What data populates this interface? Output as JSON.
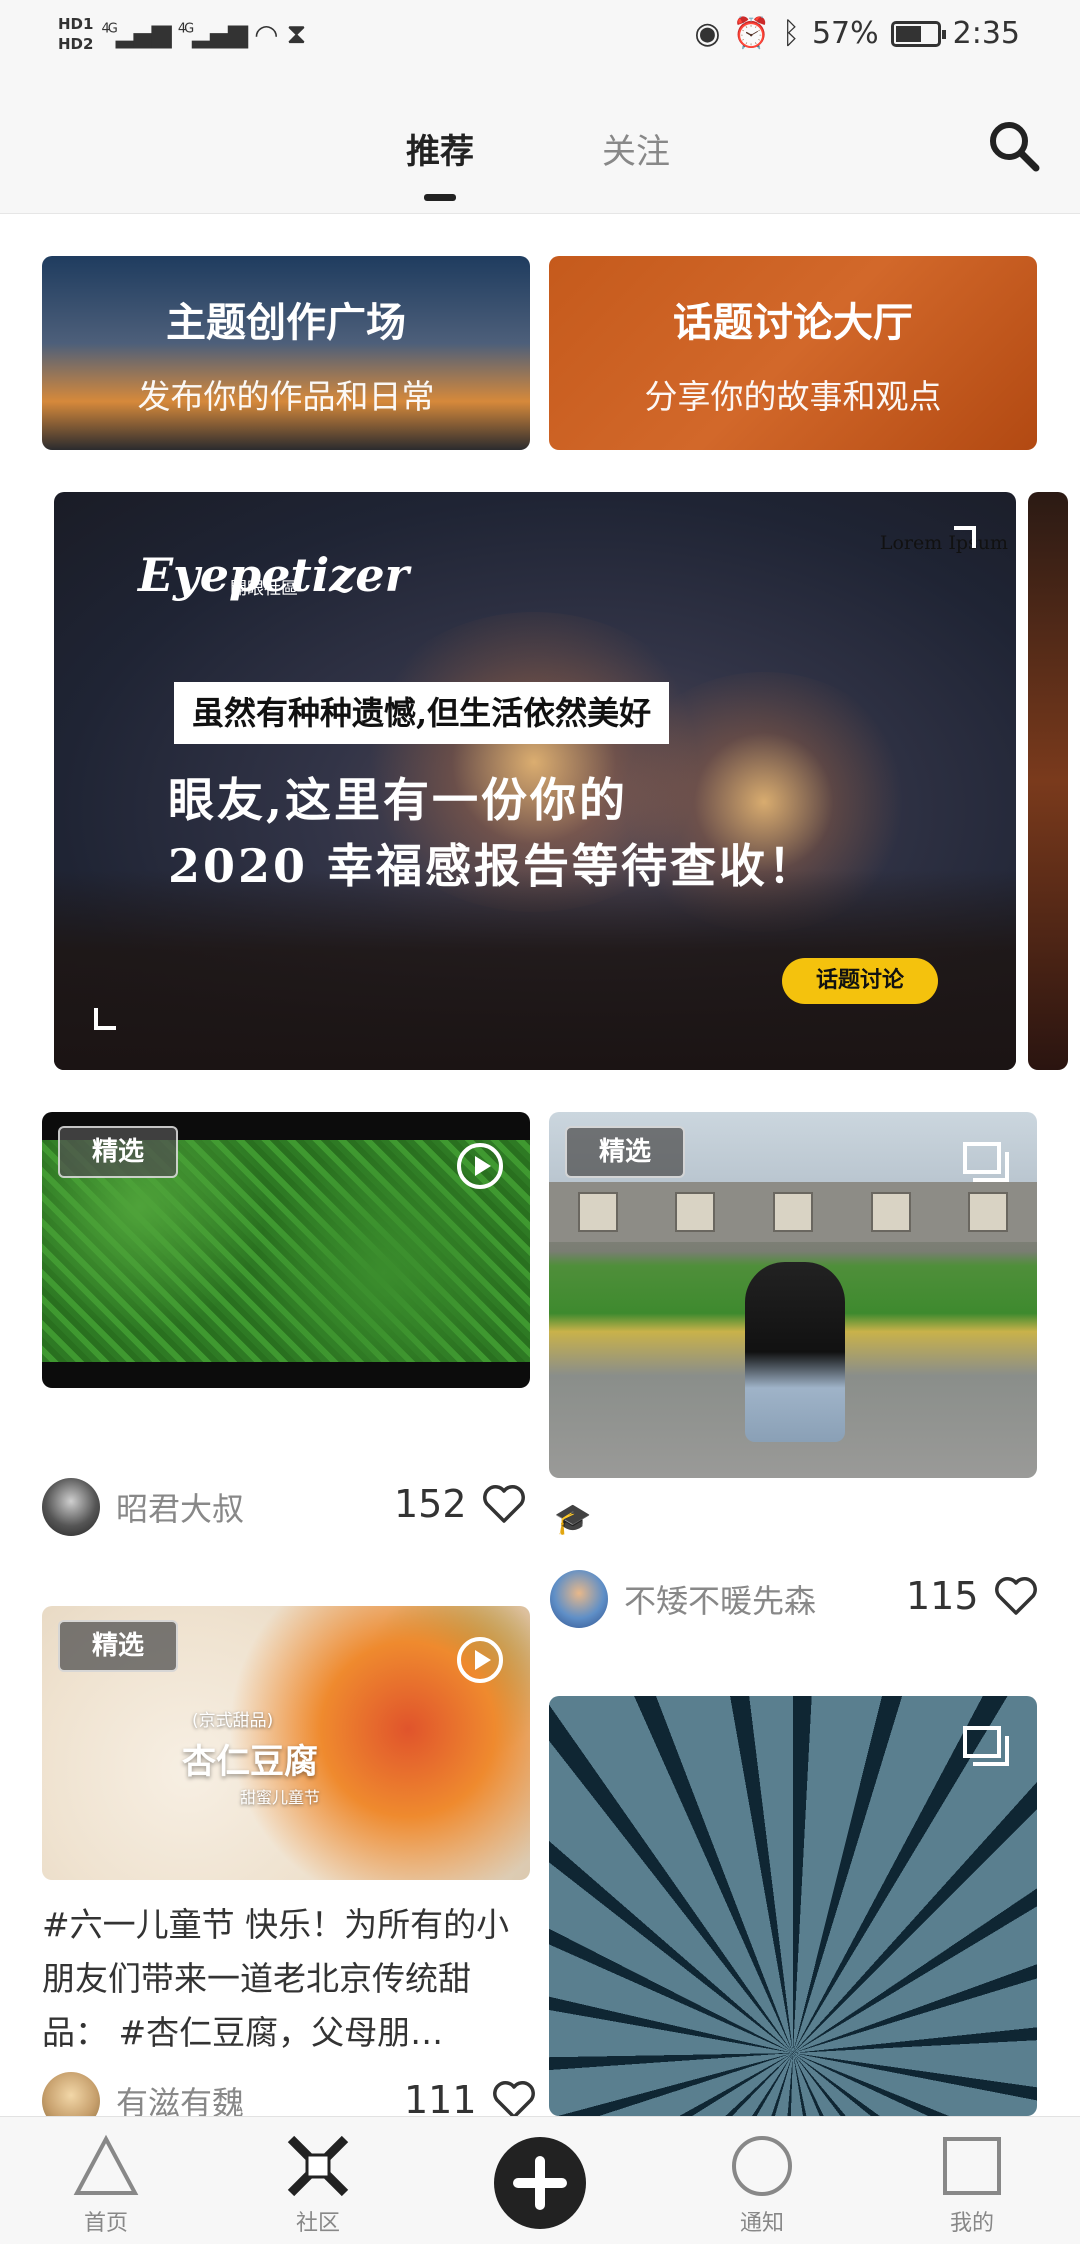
{
  "status_bar": {
    "hd1": "HD1",
    "hd2": "HD2",
    "sim_type": "4G",
    "battery_percent": "57%",
    "battery_level": 0.57,
    "time": "2:35"
  },
  "top_tabs": {
    "recommend": "推荐",
    "follow": "关注",
    "active": "推荐"
  },
  "topic_cards": [
    {
      "title": "主题创作广场",
      "subtitle": "发布你的作品和日常"
    },
    {
      "title": "话题讨论大厅",
      "subtitle": "分享你的故事和观点"
    }
  ],
  "banner": {
    "brand": "Eyepetizer",
    "brand_sub": "開眼社區",
    "lorem": "Lorem Ipsum",
    "pill": "虽然有种种遗憾,但生活依然美好",
    "line1": "眼友,这里有一份你的",
    "line2": "2020 幸福感报告等待查收！",
    "tag": "话题讨论"
  },
  "feed": {
    "card1": {
      "badge": "精选",
      "author": "昭君大叔",
      "likes": "152"
    },
    "card2": {
      "badge": "精选",
      "caption": "🎓",
      "author": "不矮不暖先森",
      "likes": "115"
    },
    "card3": {
      "badge": "精选",
      "image_caption": "(京式甜品)",
      "image_title": "杏仁豆腐",
      "image_sub": "甜蜜儿童节",
      "description": "#六一儿童节 快乐！为所有的小朋友们带来一道老北京传统甜品： #杏仁豆腐，父母朋…",
      "author": "有滋有魏",
      "likes": "111"
    }
  },
  "bottom_nav": {
    "home": "首页",
    "community": "社区",
    "notifications": "通知",
    "mine": "我的"
  },
  "colors": {
    "accent_yellow": "#f4c20d",
    "topic_orange": "#c55a1c",
    "text_dark": "#222222",
    "text_gray": "#888888"
  }
}
